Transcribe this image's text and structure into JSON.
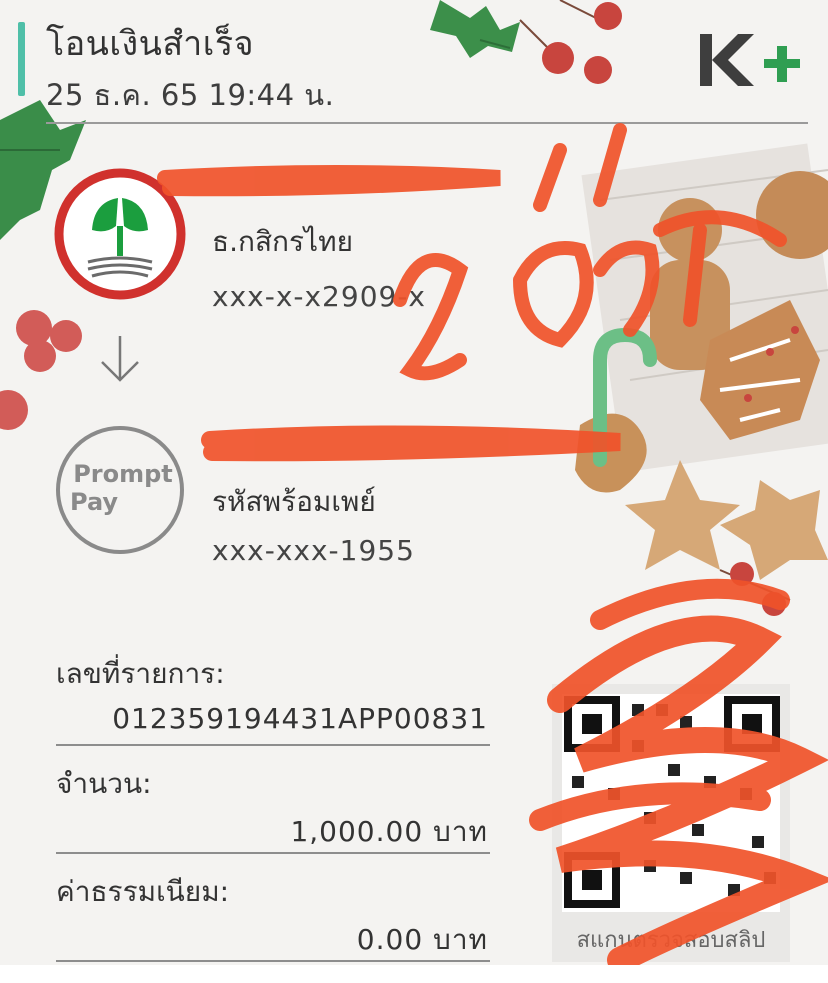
{
  "header": {
    "title": "โอนเงินสำเร็จ",
    "datetime": "25 ธ.ค. 65  19:44 น.",
    "brand_logo": "K+"
  },
  "sender": {
    "bank": "ธ.กสิกรไทย",
    "account": "xxx-x-x2909-x",
    "logo_icon": "kbank-logo-icon"
  },
  "receiver": {
    "type": "รหัสพร้อมเพย์",
    "account": "xxx-xxx-1955",
    "logo_line1": "Prompt",
    "logo_line2": "Pay"
  },
  "details": {
    "ref_label": "เลขที่รายการ:",
    "ref_value": "012359194431APP00831",
    "amount_label": "จำนวน:",
    "amount_value": "1,000.00 บาท",
    "fee_label": "ค่าธรรมเนียม:",
    "fee_value": "0.00 บาท"
  },
  "qr": {
    "caption": "สแกนตรวจสอบสลิป"
  },
  "colors": {
    "accent": "#4fbfa8",
    "kbank_green": "#1b9e3e",
    "kbank_red": "#d0312d",
    "scribble": "#f0532a"
  }
}
